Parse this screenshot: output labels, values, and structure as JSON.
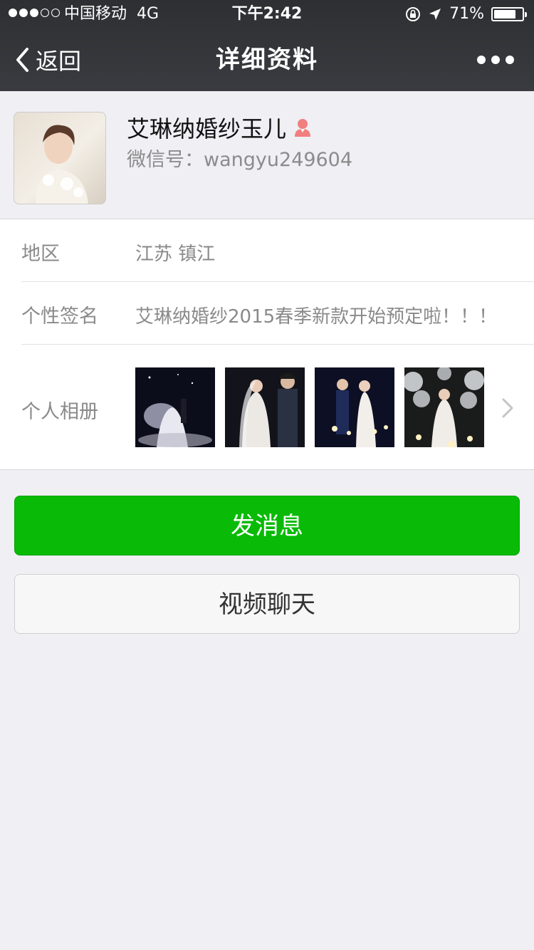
{
  "status_bar": {
    "carrier": "中国移动",
    "network": "4G",
    "time": "下午2:42",
    "battery_text": "71%",
    "battery_level": 0.71,
    "signal_bars_filled": 3,
    "signal_bars_total": 5
  },
  "nav": {
    "back_label": "返回",
    "title": "详细资料"
  },
  "profile": {
    "name": "艾琳纳婚纱玉儿",
    "wechat_id": "微信号：wangyu249604",
    "gender_icon": "female-icon"
  },
  "info": {
    "region_label": "地区",
    "region_value": "江苏 镇江",
    "signature_label": "个性签名",
    "signature_value": "艾琳纳婚纱2015春季新款开始预定啦！！！",
    "album_label": "个人相册",
    "album_photos": [
      "wedding-photo-1",
      "wedding-photo-2",
      "wedding-photo-3",
      "wedding-photo-4"
    ]
  },
  "actions": {
    "send_message": "发消息",
    "video_chat": "视频聊天"
  },
  "colors": {
    "nav_bg": "#35363a",
    "page_bg": "#efeff4",
    "primary_green": "#09bb07",
    "label_gray": "#8a8a8a",
    "female_icon": "#f17f7f"
  }
}
